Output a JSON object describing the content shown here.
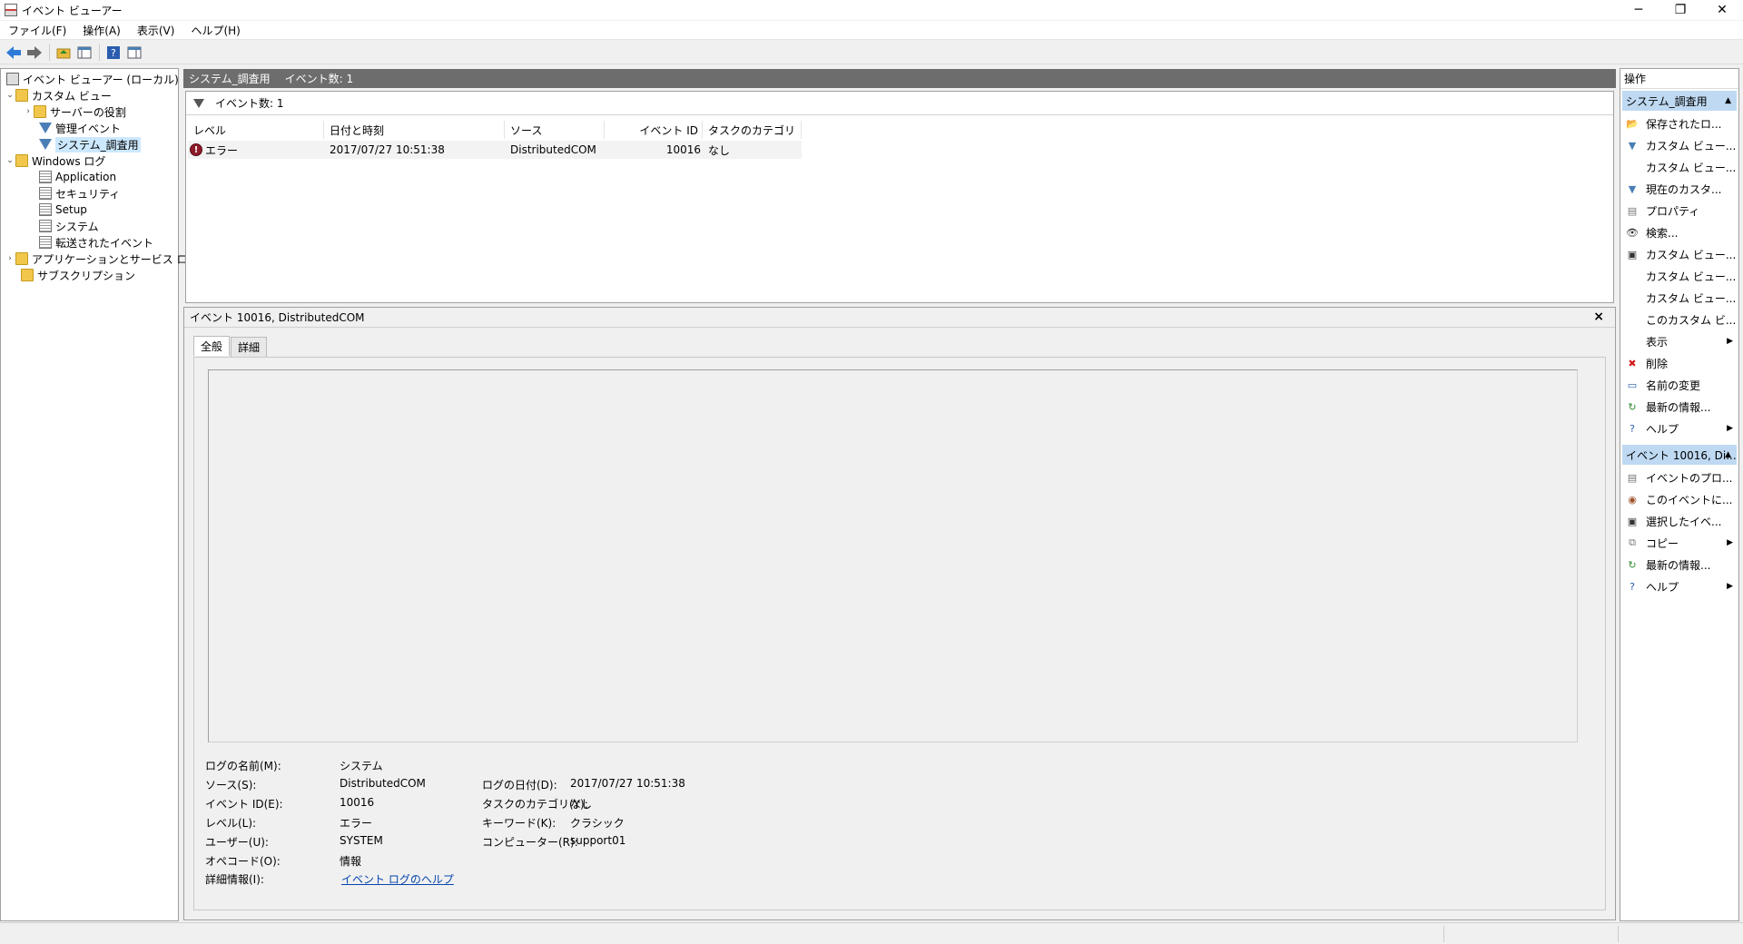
{
  "window": {
    "title": "イベント ビューアー",
    "minimize": "─",
    "restore": "❐",
    "close": "✕"
  },
  "menu": [
    "ファイル(F)",
    "操作(A)",
    "表示(V)",
    "ヘルプ(H)"
  ],
  "tree": [
    {
      "label": "イベント ビューアー (ローカル)",
      "icon": "event-viewer-icon"
    },
    {
      "label": "カスタム ビュー",
      "icon": "folder-icon",
      "expanded": true
    },
    {
      "label": "サーバーの役割",
      "icon": "folder-icon",
      "collapsed": true
    },
    {
      "label": "管理イベント",
      "icon": "filter-icon"
    },
    {
      "label": "システム_調査用",
      "icon": "filter-icon",
      "selected": true
    },
    {
      "label": "Windows ログ",
      "icon": "folder-icon",
      "expanded": true
    },
    {
      "label": "Application",
      "icon": "log-icon"
    },
    {
      "label": "セキュリティ",
      "icon": "log-icon"
    },
    {
      "label": "Setup",
      "icon": "log-icon"
    },
    {
      "label": "システム",
      "icon": "log-icon"
    },
    {
      "label": "転送されたイベント",
      "icon": "log-icon"
    },
    {
      "label": "アプリケーションとサービス ログ",
      "icon": "folder-icon",
      "collapsed": true
    },
    {
      "label": "サブスクリプション",
      "icon": "subscription-icon"
    }
  ],
  "center": {
    "title": "システム_調査用",
    "count_text": "イベント数: 1",
    "filter_text": "イベント数: 1",
    "columns": [
      "レベル",
      "日付と時刻",
      "ソース",
      "イベント ID",
      "タスクのカテゴリ"
    ],
    "rows": [
      {
        "level": "エラー",
        "datetime": "2017/07/27 10:51:38",
        "source": "DistributedCOM",
        "event_id": "10016",
        "category": "なし"
      }
    ]
  },
  "detail": {
    "header": "イベント 10016, DistributedCOM",
    "close": "×",
    "tabs": [
      "全般",
      "詳細"
    ],
    "props_left": [
      {
        "label": "ログの名前(M):",
        "value": "システム"
      },
      {
        "label": "ソース(S):",
        "value": "DistributedCOM"
      },
      {
        "label": "イベント ID(E):",
        "value": "10016"
      },
      {
        "label": "レベル(L):",
        "value": "エラー"
      },
      {
        "label": "ユーザー(U):",
        "value": "SYSTEM"
      },
      {
        "label": "オペコード(O):",
        "value": "情報"
      },
      {
        "label": "詳細情報(I):",
        "value": "イベント ログのヘルプ"
      }
    ],
    "props_right": [
      {
        "label": "ログの日付(D):",
        "value": "2017/07/27 10:51:38"
      },
      {
        "label": "タスクのカテゴリ(Y):",
        "value": "なし"
      },
      {
        "label": "キーワード(K):",
        "value": "クラシック"
      },
      {
        "label": "コンピューター(R):",
        "value": "support01"
      }
    ]
  },
  "actions": {
    "title": "操作",
    "section1": "システム_調査用",
    "items1": [
      {
        "label": "保存されたロ...",
        "icon": "open-log-icon"
      },
      {
        "label": "カスタム ビュー...",
        "icon": "filter-icon"
      },
      {
        "label": "カスタム ビュー...",
        "icon": ""
      },
      {
        "label": "現在のカスタ...",
        "icon": "filter-icon"
      },
      {
        "label": "プロパティ",
        "icon": "properties-icon"
      },
      {
        "label": "検索...",
        "icon": "binoculars-icon"
      },
      {
        "label": "カスタム ビュー...",
        "icon": "save-icon"
      },
      {
        "label": "カスタム ビュー...",
        "icon": ""
      },
      {
        "label": "カスタム ビュー...",
        "icon": ""
      },
      {
        "label": "このカスタム ビ...",
        "icon": ""
      },
      {
        "label": "表示",
        "icon": "",
        "submenu": true
      },
      {
        "label": "削除",
        "icon": "delete-icon"
      },
      {
        "label": "名前の変更",
        "icon": "rename-icon"
      },
      {
        "label": "最新の情報...",
        "icon": "refresh-icon"
      },
      {
        "label": "ヘルプ",
        "icon": "help-icon",
        "submenu": true
      }
    ],
    "section2": "イベント 10016, Di...",
    "items2": [
      {
        "label": "イベントのプロ...",
        "icon": "properties-icon"
      },
      {
        "label": "このイベントに...",
        "icon": "task-icon"
      },
      {
        "label": "選択したイベ...",
        "icon": "save-icon"
      },
      {
        "label": "コピー",
        "icon": "copy-icon",
        "submenu": true
      },
      {
        "label": "最新の情報...",
        "icon": "refresh-icon"
      },
      {
        "label": "ヘルプ",
        "icon": "help-icon",
        "submenu": true
      }
    ]
  },
  "colors": {
    "accent": "#bfd9f2",
    "header_bg": "#6d6d6d",
    "error": "#8e1a2a",
    "link": "#0645ad"
  }
}
